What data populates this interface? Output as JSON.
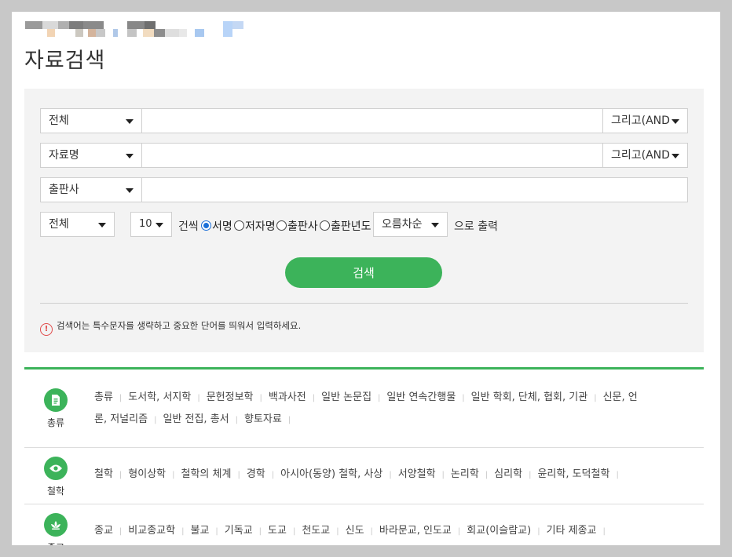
{
  "page_title": "자료검색",
  "rows": [
    {
      "field": "전체",
      "logic": "그리고(AND"
    },
    {
      "field": "자료명",
      "logic": "그리고(AND"
    },
    {
      "field": "출판사"
    }
  ],
  "options": {
    "scope": "전체",
    "count": "10",
    "count_suffix": "건씩",
    "sort_radios": [
      {
        "label": "서명",
        "checked": true
      },
      {
        "label": "저자명",
        "checked": false
      },
      {
        "label": "출판사",
        "checked": false
      },
      {
        "label": "출판년도",
        "checked": false
      }
    ],
    "order": "오름차순",
    "output_suffix": "으로 출력"
  },
  "search_button": "검색",
  "notice": "검색어는 특수문자를 생략하고 중요한 단어를 띄워서 입력하세요.",
  "colors": {
    "accent": "#3cb35a",
    "warning": "#e04a4a"
  },
  "categories": [
    {
      "label": "총류",
      "icon": "document-icon",
      "links": [
        "총류",
        "도서학, 서지학",
        "문헌정보학",
        "백과사전",
        "일반 논문집",
        "일반 연속간행물",
        "일반 학회, 단체, 협회, 기관",
        "신문, 언론, 저널리즘",
        "일반 전집, 총서",
        "향토자료"
      ]
    },
    {
      "label": "철학",
      "icon": "eye-icon",
      "links": [
        "철학",
        "형이상학",
        "철학의 체계",
        "경학",
        "아시아(동양) 철학, 사상",
        "서양철학",
        "논리학",
        "심리학",
        "윤리학, 도덕철학"
      ]
    },
    {
      "label": "종교",
      "icon": "lotus-icon",
      "links": [
        "종교",
        "비교종교학",
        "불교",
        "기독교",
        "도교",
        "천도교",
        "신도",
        "바라문교, 인도교",
        "회교(이슬람교)",
        "기타 제종교"
      ]
    }
  ]
}
